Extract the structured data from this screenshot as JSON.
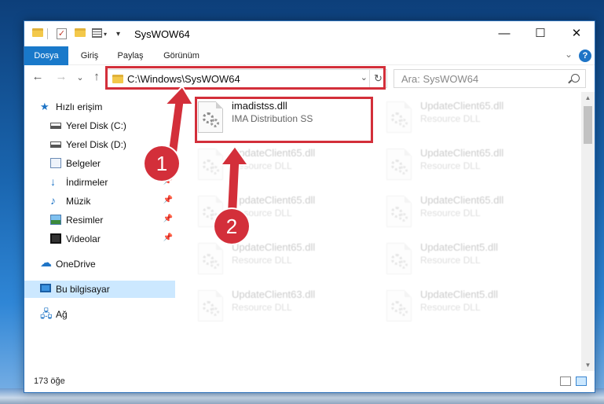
{
  "window": {
    "title": "SysWOW64",
    "controls": {
      "minimize": "—",
      "maximize": "☐",
      "close": "✕"
    }
  },
  "ribbon": {
    "tabs": [
      "Dosya",
      "Giriş",
      "Paylaş",
      "Görünüm"
    ],
    "help": "?"
  },
  "nav": {
    "back": "←",
    "forward": "→",
    "recent": "⌄",
    "up": "↑",
    "address": "C:\\Windows\\SysWOW64",
    "refresh": "↻",
    "search_placeholder": "Ara: SysWOW64"
  },
  "sidebar": {
    "items": [
      {
        "label": "Hızlı erişim",
        "icon": "star-icon",
        "pinned": false,
        "top": true
      },
      {
        "label": "Yerel Disk (C:)",
        "icon": "drive-icon",
        "pinned": false
      },
      {
        "label": "Yerel Disk (D:)",
        "icon": "drive-icon",
        "pinned": false
      },
      {
        "label": "Belgeler",
        "icon": "documents-icon",
        "pinned": false
      },
      {
        "label": "İndirmeler",
        "icon": "downloads-icon",
        "pinned": true
      },
      {
        "label": "Müzik",
        "icon": "music-icon",
        "pinned": true
      },
      {
        "label": "Resimler",
        "icon": "pictures-icon",
        "pinned": true
      },
      {
        "label": "Videolar",
        "icon": "videos-icon",
        "pinned": true
      },
      {
        "label": "OneDrive",
        "icon": "onedrive-icon",
        "pinned": false,
        "top": true
      },
      {
        "label": "Bu bilgisayar",
        "icon": "this-pc-icon",
        "pinned": false,
        "top": true,
        "selected": true
      },
      {
        "label": "Ağ",
        "icon": "network-icon",
        "pinned": false,
        "top": true
      }
    ]
  },
  "files": [
    {
      "name": "imadistss.dll",
      "desc": "IMA Distribution SS",
      "highlighted": true
    },
    {
      "name": "UpdateClient65.dll",
      "desc": "Resource DLL"
    },
    {
      "name": "UpdateClient65.dll",
      "desc": "Resource DLL"
    },
    {
      "name": "UpdateClient65.dll",
      "desc": "Resource DLL"
    },
    {
      "name": "UpdateClient65.dll",
      "desc": "Resource DLL"
    },
    {
      "name": "UpdateClient65.dll",
      "desc": "Resource DLL"
    },
    {
      "name": "UpdateClient65.dll",
      "desc": "Resource DLL"
    },
    {
      "name": "UpdateClient5.dll",
      "desc": "Resource DLL"
    },
    {
      "name": "UpdateClient63.dll",
      "desc": "Resource DLL"
    },
    {
      "name": "UpdateClient5.dll",
      "desc": "Resource DLL"
    }
  ],
  "status": {
    "item_count": "173 öğe"
  },
  "callouts": [
    "1",
    "2"
  ],
  "colors": {
    "accent": "#1979ca",
    "highlight": "#d32f3a",
    "selected": "#cce8ff"
  }
}
